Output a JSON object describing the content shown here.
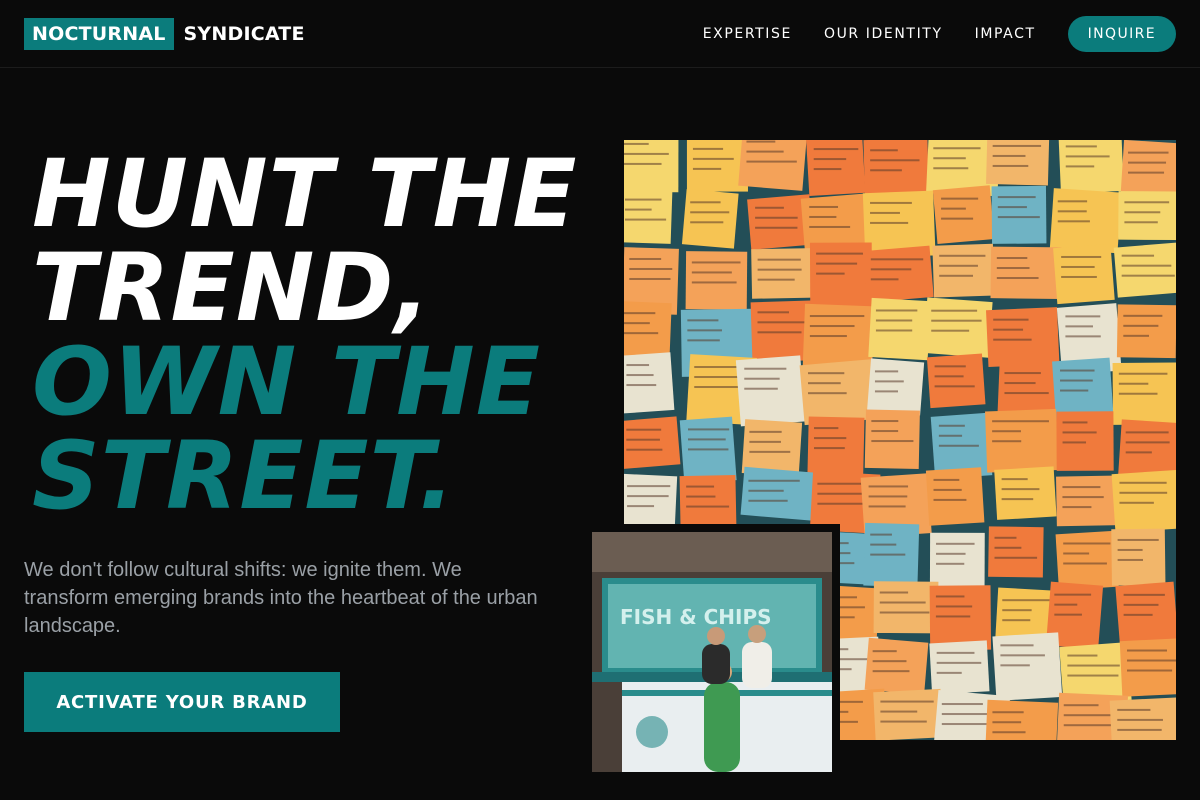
{
  "header": {
    "logo_box": "NOCTURNAL",
    "logo_text": "SYNDICATE",
    "nav": [
      "EXPERTISE",
      "OUR IDENTITY",
      "IMPACT"
    ],
    "cta": "INQUIRE"
  },
  "hero": {
    "line1": "HUNT THE",
    "line2": "TREND,",
    "line3": "OWN THE",
    "line4": "STREET.",
    "tagline": "We don't follow cultural shifts: we ignite them. We transform emerging brands into the heartbeat of the urban landscape.",
    "cta": "ACTIVATE YOUR BRAND"
  },
  "colors": {
    "accent": "#0b7c7c",
    "background": "#0a0a0a",
    "muted_text": "#9aa0a6"
  }
}
